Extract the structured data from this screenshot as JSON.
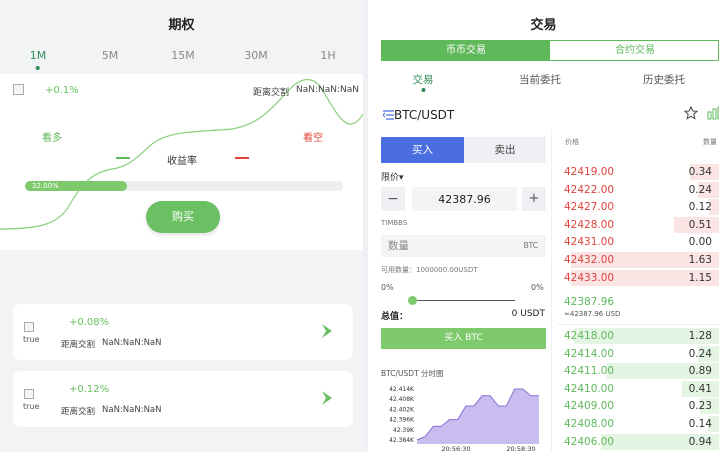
{
  "left": {
    "title": "期权",
    "tabs": [
      {
        "label": "1M",
        "active": true
      },
      {
        "label": "5M",
        "active": false
      },
      {
        "label": "15M",
        "active": false
      },
      {
        "label": "30M",
        "active": false
      },
      {
        "label": "1H",
        "active": false
      }
    ],
    "chart": {
      "change": "+0.1%",
      "distance_label": "距离交割",
      "distance_value": "NaN:NaN:NaN",
      "bull_label": "看多",
      "bear_label": "看空",
      "rate_label": "收益率",
      "progress_text": "32.00%",
      "progress_percent": 32,
      "buy_label": "购买"
    },
    "positions": [
      {
        "img_alt": "true",
        "change": "+0.08%",
        "distance_label": "距离交割",
        "distance_value": "NaN:NaN:NaN"
      },
      {
        "img_alt": "true",
        "change": "+0.12%",
        "distance_label": "距离交割",
        "distance_value": "NaN:NaN:NaN"
      }
    ]
  },
  "right": {
    "title": "交易",
    "segments": {
      "spot": "币币交易",
      "contract": "合约交易"
    },
    "subtabs": [
      {
        "label": "交易",
        "active": true
      },
      {
        "label": "当前委托",
        "active": false
      },
      {
        "label": "历史委托",
        "active": false
      }
    ],
    "pair": "BTC/USDT",
    "form": {
      "buy_label": "买入",
      "sell_label": "卖出",
      "order_type": "限价▾",
      "minus": "−",
      "price_value": "42387.96",
      "plus": "+",
      "timbbs": "TIMBBS",
      "qty_placeholder": "数量",
      "qty_unit": "BTC",
      "available": "可用数量：1000000.00USDT",
      "pct_left": "0%",
      "pct_right": "0%",
      "slider_percent": 0,
      "total_label": "总值：",
      "total_value": "0 USDT",
      "submit_label": "买入 BTC",
      "mini_chart_title": "BTC/USDT 分时图"
    },
    "orderbook": {
      "header_price": "价格",
      "header_qty": "数量",
      "asks": [
        {
          "price": "42419.00",
          "qty": "0.34",
          "depth": 0.18
        },
        {
          "price": "42422.00",
          "qty": "0.24",
          "depth": 0.13
        },
        {
          "price": "42427.00",
          "qty": "0.12",
          "depth": 0.06
        },
        {
          "price": "42428.00",
          "qty": "0.51",
          "depth": 0.28
        },
        {
          "price": "42431.00",
          "qty": "0.00",
          "depth": 0
        },
        {
          "price": "42432.00",
          "qty": "1.63",
          "depth": 0.92
        },
        {
          "price": "42433.00",
          "qty": "1.15",
          "depth": 0.92
        }
      ],
      "mid_price": "42387.96",
      "mid_usd": "≈42387.96 USD",
      "bids": [
        {
          "price": "42418.00",
          "qty": "1.28",
          "depth": 0.9
        },
        {
          "price": "42414.00",
          "qty": "0.24",
          "depth": 0.13
        },
        {
          "price": "42411.00",
          "qty": "0.89",
          "depth": 0.7
        },
        {
          "price": "42410.00",
          "qty": "0.41",
          "depth": 0.23
        },
        {
          "price": "42409.00",
          "qty": "0.23",
          "depth": 0.12
        },
        {
          "price": "42408.00",
          "qty": "0.14",
          "depth": 0.07
        },
        {
          "price": "42406.00",
          "qty": "0.94",
          "depth": 0.73
        }
      ]
    },
    "mini_chart": {
      "y_ticks": [
        "42.414K",
        "42.408K",
        "42.402K",
        "42.396K",
        "42.39K",
        "42.384K"
      ],
      "x_ticks": [
        "20:56:30",
        "20:58:30"
      ],
      "y_values": [
        42.384,
        42.386,
        42.392,
        42.392,
        42.396,
        42.396,
        42.404,
        42.404,
        42.41,
        42.41,
        42.404,
        42.404,
        42.414,
        42.414,
        42.41,
        42.41
      ]
    }
  },
  "colors": {
    "up": "#5fb85a",
    "down": "#e0433c",
    "ask_depth": "#fbe4e4",
    "bid_depth": "#e4f5e4",
    "buy_blue": "#4a6ee0"
  }
}
